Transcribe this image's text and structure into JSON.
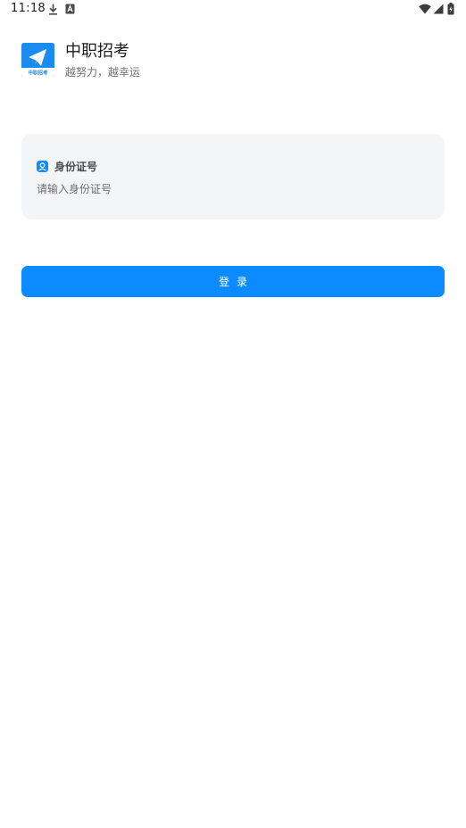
{
  "status_bar": {
    "time": "11:18",
    "left_icons": [
      "download-icon",
      "keyboard-a-icon"
    ],
    "right_icons": [
      "wifi-icon",
      "cell-signal-icon",
      "battery-charging-icon"
    ]
  },
  "app": {
    "name": "中职招考",
    "slogan": "越努力，越幸运",
    "logo_icon": "paper-plane-icon",
    "logo_caption": "中职招考",
    "brand_color": "#0b8bff"
  },
  "form": {
    "id_label": "身份证号",
    "id_label_icon": "user-icon",
    "id_placeholder": "请输入身份证号",
    "id_value": "",
    "card_background": "#f4f5f7"
  },
  "login": {
    "label": "登录"
  }
}
